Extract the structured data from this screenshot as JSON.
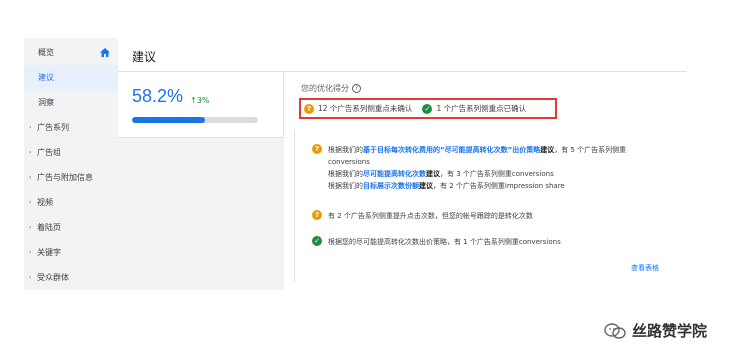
{
  "sidebar": {
    "items": [
      {
        "label": "概览",
        "caret": "",
        "active": false
      },
      {
        "label": "建议",
        "caret": "",
        "active": true
      },
      {
        "label": "洞察",
        "caret": "",
        "active": false
      },
      {
        "label": "广告系列",
        "caret": "›",
        "active": false
      },
      {
        "label": "广告组",
        "caret": "›",
        "active": false
      },
      {
        "label": "广告与附加信息",
        "caret": "›",
        "active": false
      },
      {
        "label": "视频",
        "caret": "›",
        "active": false
      },
      {
        "label": "着陆页",
        "caret": "›",
        "active": false
      },
      {
        "label": "关键字",
        "caret": "›",
        "active": false
      },
      {
        "label": "受众群体",
        "caret": "›",
        "active": false
      }
    ]
  },
  "header": {
    "title": "建议"
  },
  "score": {
    "value": "58.2%",
    "delta": "3%",
    "delta_arrow": "↑",
    "progress_fraction": 0.582
  },
  "optimization": {
    "label": "您的优化得分",
    "status_unconfirmed": "12 个广告系列侧重点未确认",
    "status_confirmed": "1 个广告系列侧重点已确认"
  },
  "recommendations": {
    "r1": {
      "line1_prefix": "根据我们的",
      "line1_link": "基于目标每次转化费用的“尽可能提高转化次数”出价策略",
      "line1_bold": "建议",
      "line1_suffix": "，有 5 个广告系列侧重",
      "line2": "conversions",
      "line3_prefix": "根据我们的",
      "line3_link": "尽可能提高转化次数",
      "line3_bold": "建议",
      "line3_suffix": "，有 3 个广告系列侧重conversions",
      "line4_prefix": "根据我们的",
      "line4_link": "目标展示次数份额",
      "line4_bold": "建议",
      "line4_suffix": "，有 2 个广告系列侧重impression share"
    },
    "r2": "有 2 个广告系列侧重提升点击次数，但您的帐号跟踪的是转化次数",
    "r3": "根据您的尽可能提高转化次数出价策略，有 1 个广告系列侧重conversions",
    "view_table": "查看表格"
  },
  "watermark": {
    "text": "丝路赞学院"
  },
  "colors": {
    "accent": "#1a73e8",
    "warning": "#f29900",
    "success": "#1e8e3e",
    "highlight_border": "#e53935"
  }
}
